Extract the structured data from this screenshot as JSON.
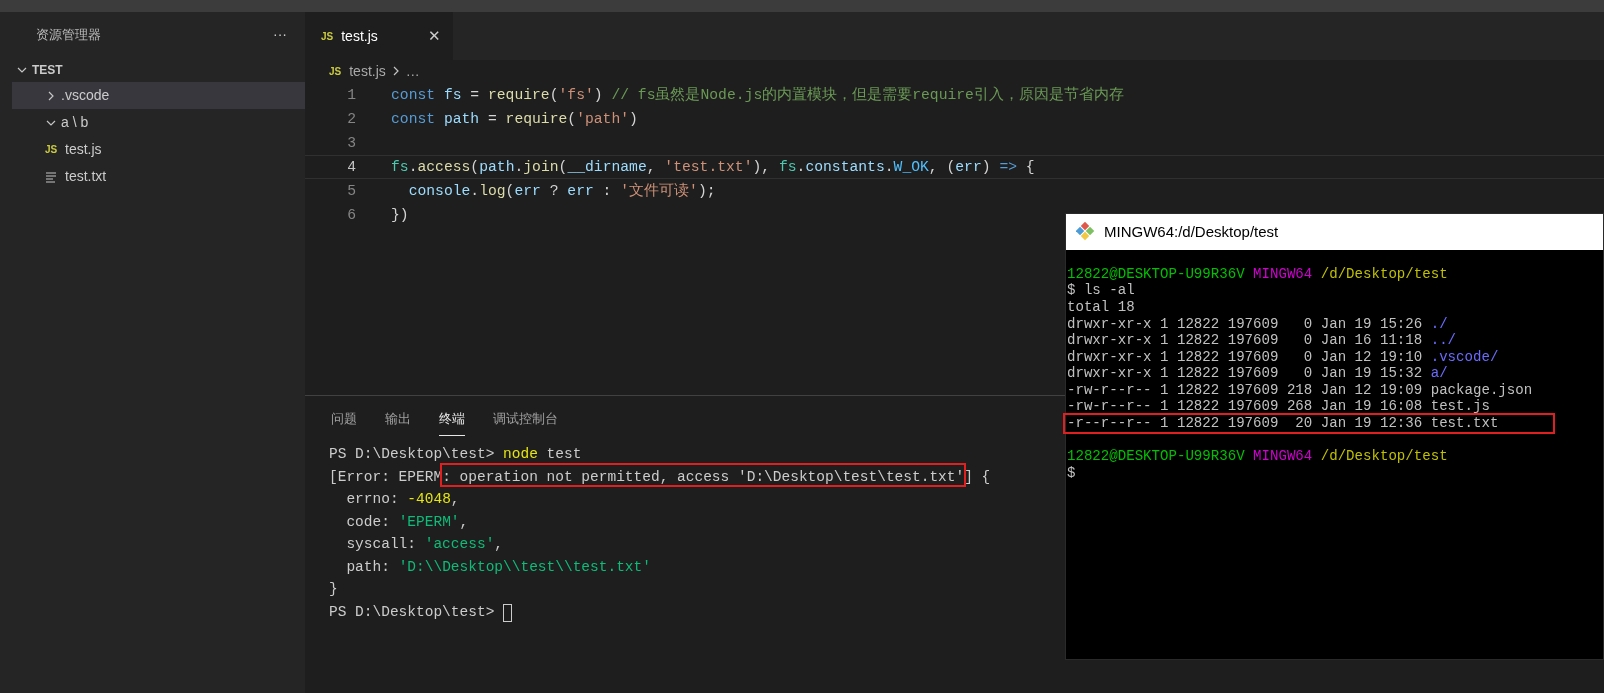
{
  "sidebar": {
    "title": "资源管理器",
    "more": "···",
    "root": {
      "label": "TEST",
      "expanded": true,
      "children": [
        {
          "label": ".vscode",
          "kind": "folder",
          "expanded": false,
          "selected": true
        },
        {
          "label": "a \\ b",
          "kind": "folder",
          "expanded": true,
          "selected": false
        },
        {
          "label": "test.js",
          "kind": "js",
          "badge": "JS",
          "selected": false
        },
        {
          "label": "test.txt",
          "kind": "text",
          "selected": false
        }
      ]
    }
  },
  "tabs": [
    {
      "label": "test.js",
      "badge": "JS",
      "close": "✕",
      "selected": true
    }
  ],
  "breadcrumb": {
    "badge": "JS",
    "items": [
      "test.js",
      "…"
    ]
  },
  "code": [
    {
      "number": "1",
      "current": false,
      "tokens": [
        {
          "text": "const ",
          "kind": "kw"
        },
        {
          "text": "fs",
          "kind": "var"
        },
        {
          "text": " = ",
          "kind": "plain"
        },
        {
          "text": "require",
          "kind": "fn"
        },
        {
          "text": "(",
          "kind": "plain"
        },
        {
          "text": "'fs'",
          "kind": "str"
        },
        {
          "text": ") ",
          "kind": "plain"
        },
        {
          "text": "// fs虽然是Node.js的内置模块，但是需要require引入，原因是节省内存",
          "kind": "comment"
        }
      ]
    },
    {
      "number": "2",
      "current": false,
      "tokens": [
        {
          "text": "const ",
          "kind": "kw"
        },
        {
          "text": "path",
          "kind": "var"
        },
        {
          "text": " = ",
          "kind": "plain"
        },
        {
          "text": "require",
          "kind": "fn"
        },
        {
          "text": "(",
          "kind": "plain"
        },
        {
          "text": "'path'",
          "kind": "str"
        },
        {
          "text": ")",
          "kind": "plain"
        }
      ]
    },
    {
      "number": "3",
      "current": false
    },
    {
      "number": "4",
      "current": true,
      "tokens": [
        {
          "text": "fs",
          "kind": "module"
        },
        {
          "text": ".",
          "kind": "plain"
        },
        {
          "text": "access",
          "kind": "fn"
        },
        {
          "text": "(",
          "kind": "plain"
        },
        {
          "text": "path",
          "kind": "var"
        },
        {
          "text": ".",
          "kind": "plain"
        },
        {
          "text": "join",
          "kind": "fn"
        },
        {
          "text": "(",
          "kind": "plain"
        },
        {
          "text": "__dirname",
          "kind": "var"
        },
        {
          "text": ", ",
          "kind": "plain"
        },
        {
          "text": "'test.txt'",
          "kind": "str"
        },
        {
          "text": "), ",
          "kind": "plain"
        },
        {
          "text": "fs",
          "kind": "module"
        },
        {
          "text": ".",
          "kind": "plain"
        },
        {
          "text": "constants",
          "kind": "var"
        },
        {
          "text": ".",
          "kind": "plain"
        },
        {
          "text": "W_OK",
          "kind": "const"
        },
        {
          "text": ", (",
          "kind": "plain"
        },
        {
          "text": "err",
          "kind": "var"
        },
        {
          "text": ") ",
          "kind": "plain"
        },
        {
          "text": "=>",
          "kind": "kw"
        },
        {
          "text": " {",
          "kind": "plain"
        }
      ]
    },
    {
      "number": "5",
      "current": false,
      "tokens": [
        {
          "text": "  console",
          "kind": "var"
        },
        {
          "text": ".",
          "kind": "plain"
        },
        {
          "text": "log",
          "kind": "fn"
        },
        {
          "text": "(",
          "kind": "plain"
        },
        {
          "text": "err",
          "kind": "var"
        },
        {
          "text": " ? ",
          "kind": "plain"
        },
        {
          "text": "err",
          "kind": "var"
        },
        {
          "text": " : ",
          "kind": "plain"
        },
        {
          "text": "'文件可读'",
          "kind": "str"
        },
        {
          "text": ");",
          "kind": "plain"
        }
      ]
    },
    {
      "number": "6",
      "current": false,
      "tokens": [
        {
          "text": "})",
          "kind": "plain"
        }
      ]
    }
  ],
  "panel": {
    "tabs": [
      {
        "label": "问题",
        "selected": false
      },
      {
        "label": "输出",
        "selected": false
      },
      {
        "label": "终端",
        "selected": true
      },
      {
        "label": "调试控制台",
        "selected": false
      }
    ],
    "terminal": [
      {
        "cursor": false,
        "tokens": [
          {
            "text": "PS D:\\Desktop\\test> ",
            "kind": "plain"
          },
          {
            "text": "node",
            "kind": "cmd"
          },
          {
            "text": " test",
            "kind": "plain"
          }
        ]
      },
      {
        "cursor": false,
        "tokens": [
          {
            "text": "[Error: EPERM",
            "kind": "plain",
            "highlighted": false
          },
          {
            "text": ": operation not permitted, access 'D:\\Desktop\\test\\test.txt'",
            "kind": "plain",
            "highlighted": true
          },
          {
            "text": "] {",
            "kind": "plain",
            "highlighted": false
          }
        ]
      },
      {
        "cursor": false,
        "tokens": [
          {
            "text": "  errno: ",
            "kind": "plain"
          },
          {
            "text": "-4048",
            "kind": "num"
          },
          {
            "text": ",",
            "kind": "plain"
          }
        ]
      },
      {
        "cursor": false,
        "tokens": [
          {
            "text": "  code: ",
            "kind": "plain"
          },
          {
            "text": "'EPERM'",
            "kind": "str"
          },
          {
            "text": ",",
            "kind": "plain"
          }
        ]
      },
      {
        "cursor": false,
        "tokens": [
          {
            "text": "  syscall: ",
            "kind": "plain"
          },
          {
            "text": "'access'",
            "kind": "str"
          },
          {
            "text": ",",
            "kind": "plain"
          }
        ]
      },
      {
        "cursor": false,
        "tokens": [
          {
            "text": "  path: ",
            "kind": "plain"
          },
          {
            "text": "'D:\\\\Desktop\\\\test\\\\test.txt'",
            "kind": "str"
          }
        ]
      },
      {
        "cursor": false,
        "tokens": [
          {
            "text": "}",
            "kind": "plain"
          }
        ]
      },
      {
        "cursor": true,
        "tokens": [
          {
            "text": "PS D:\\Desktop\\test> ",
            "kind": "plain"
          }
        ]
      }
    ]
  },
  "mingw": {
    "title": "MINGW64:/d/Desktop/test",
    "lines": [
      {
        "highlighted": false,
        "tokens": [
          {
            "text": "12822@DESKTOP-U99R36V ",
            "kind": "user"
          },
          {
            "text": "MINGW64 ",
            "kind": "host"
          },
          {
            "text": "/d/Desktop/test",
            "kind": "path"
          }
        ]
      },
      {
        "highlighted": false,
        "tokens": [
          {
            "text": "$ ls -al",
            "kind": "plain"
          }
        ]
      },
      {
        "highlighted": false,
        "tokens": [
          {
            "text": "total 18",
            "kind": "plain"
          }
        ]
      },
      {
        "highlighted": false,
        "tokens": [
          {
            "text": "drwxr-xr-x 1 12822 197609   0 Jan 19 15:26 ",
            "kind": "plain"
          },
          {
            "text": "./",
            "kind": "dir"
          }
        ]
      },
      {
        "highlighted": false,
        "tokens": [
          {
            "text": "drwxr-xr-x 1 12822 197609   0 Jan 16 11:18 ",
            "kind": "plain"
          },
          {
            "text": "../",
            "kind": "dir"
          }
        ]
      },
      {
        "highlighted": false,
        "tokens": [
          {
            "text": "drwxr-xr-x 1 12822 197609   0 Jan 12 19:10 ",
            "kind": "plain"
          },
          {
            "text": ".vscode/",
            "kind": "dir"
          }
        ]
      },
      {
        "highlighted": false,
        "tokens": [
          {
            "text": "drwxr-xr-x 1 12822 197609   0 Jan 19 15:32 ",
            "kind": "plain"
          },
          {
            "text": "a/",
            "kind": "dir"
          }
        ]
      },
      {
        "highlighted": false,
        "tokens": [
          {
            "text": "-rw-r--r-- 1 12822 197609 218 Jan 12 19:09 package.json",
            "kind": "plain"
          }
        ]
      },
      {
        "highlighted": false,
        "tokens": [
          {
            "text": "-rw-r--r-- 1 12822 197609 268 Jan 19 16:08 test.js",
            "kind": "plain"
          }
        ]
      },
      {
        "highlighted": true,
        "tokens": [
          {
            "text": "-r--r--r-- 1 12822 197609  20 Jan 19 12:36 test.txt",
            "kind": "plain"
          }
        ]
      },
      {
        "highlighted": false
      },
      {
        "highlighted": false,
        "tokens": [
          {
            "text": "12822@DESKTOP-U99R36V ",
            "kind": "user"
          },
          {
            "text": "MINGW64 ",
            "kind": "host"
          },
          {
            "text": "/d/Desktop/test",
            "kind": "path"
          }
        ]
      },
      {
        "highlighted": false,
        "tokens": [
          {
            "text": "$",
            "kind": "plain"
          }
        ]
      }
    ]
  }
}
